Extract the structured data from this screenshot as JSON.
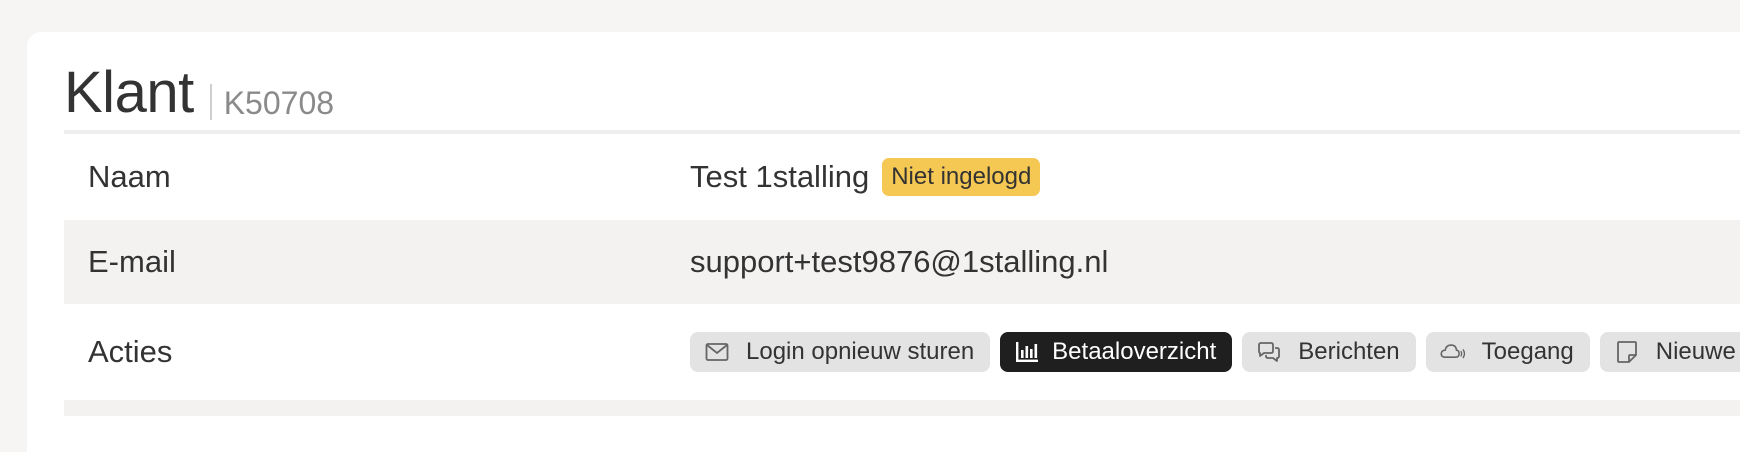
{
  "header": {
    "title": "Klant",
    "customer_id": "K50708"
  },
  "rows": {
    "naam": {
      "label": "Naam",
      "value": "Test 1stalling",
      "badge": "Niet ingelogd",
      "badge_color": "#f5c753"
    },
    "email": {
      "label": "E-mail",
      "value": "support+test9876@1stalling.nl"
    },
    "acties": {
      "label": "Acties",
      "buttons": [
        {
          "label": "Login opnieuw sturen",
          "icon": "envelope-icon",
          "active": false
        },
        {
          "label": "Betaaloverzicht",
          "icon": "bar-chart-icon",
          "active": true
        },
        {
          "label": "Berichten",
          "icon": "chat-bubbles-icon",
          "active": false
        },
        {
          "label": "Toegang",
          "icon": "cloud-signal-icon",
          "active": false
        },
        {
          "label": "Nieuwe t",
          "icon": "note-icon",
          "active": false
        }
      ]
    }
  },
  "colors": {
    "background": "#f6f5f4",
    "card": "#ffffff",
    "alt_row": "#f3f2f1",
    "active_button": "#1f1f1f",
    "button": "#e3e3e3"
  }
}
